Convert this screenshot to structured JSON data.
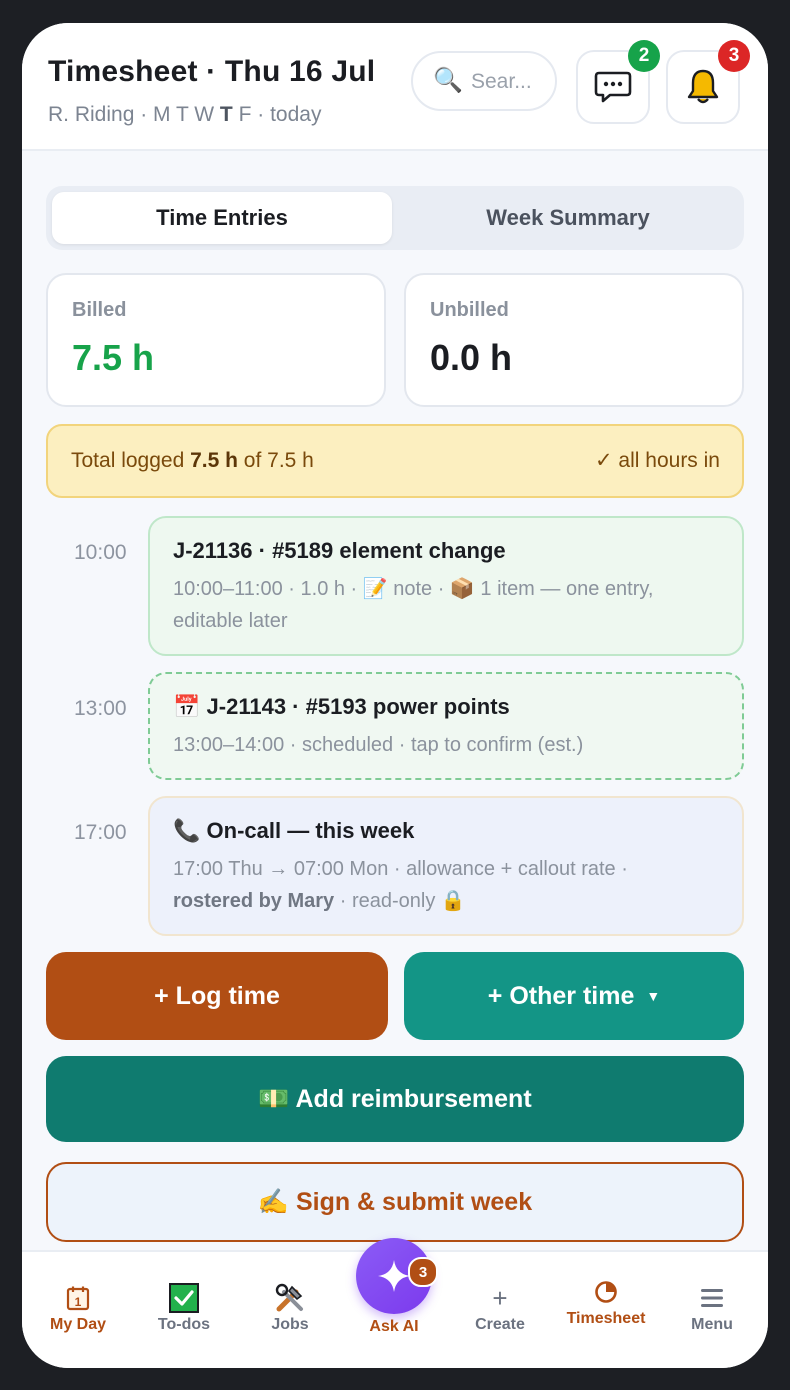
{
  "header": {
    "title": "Timesheet · Thu 16 Jul",
    "subtitle_prefix": "R. Riding · M T W ",
    "subtitle_bold": "T",
    "subtitle_suffix": " F · today",
    "search_placeholder": "Sear...",
    "search_icon": "magnifier-icon",
    "messages_icon": "chat-bubble-icon",
    "messages_count": "2",
    "notifications_icon": "bell-icon",
    "notifications_count": "3"
  },
  "tabs": [
    {
      "label": "Time Entries",
      "active": true
    },
    {
      "label": "Week Summary",
      "active": false
    }
  ],
  "stats": {
    "billed_label": "Billed",
    "billed_value": "7.5 h",
    "unbilled_label": "Unbilled",
    "unbilled_value": "0.0 h"
  },
  "total": {
    "prefix": "Total logged ",
    "logged": "7.5 h",
    "suffix": " of 7.5 h",
    "status": "✓ all hours in"
  },
  "entries": [
    {
      "time": "10:00",
      "title": "J-21136 · #5189 element change",
      "meta": "10:00–11:00 · 1.0 h · 📝 note · 📦 1 item — one entry, editable later"
    },
    {
      "time": "13:00",
      "icon": "📅",
      "title": "J-21143 · #5193 power points",
      "meta": "13:00–14:00 · scheduled · tap to confirm (est.)"
    },
    {
      "time": "17:00",
      "icon": "📞",
      "title": "On-call — this week",
      "meta_prefix": "17:00 Thu → 07:00 Mon · allowance + callout rate · ",
      "meta_bold": "rostered by Mary",
      "meta_suffix": " · read-only 🔒"
    }
  ],
  "actions": {
    "log_time": "+ Log time",
    "other_time": "+ Other time",
    "reimbursement": "💵 Add reimbursement",
    "sign_submit": "✍️ Sign & submit week"
  },
  "nav": [
    {
      "label": "My Day",
      "icon": "calendar-icon",
      "active": true
    },
    {
      "label": "To-dos",
      "icon": "checkbox-icon",
      "active": false
    },
    {
      "label": "Jobs",
      "icon": "tools-icon",
      "active": false
    },
    {
      "label": "Ask AI",
      "icon": "sparkle-icon",
      "badge": "3",
      "active": true
    },
    {
      "label": "Create",
      "icon": "plus-icon",
      "active": false
    },
    {
      "label": "Timesheet",
      "icon": "pie-chart-icon",
      "active": true
    },
    {
      "label": "Menu",
      "icon": "hamburger-icon",
      "active": false
    }
  ],
  "colors": {
    "accent": "#b14e14",
    "teal": "#139586",
    "teal_dark": "#0f7b6f",
    "billed_green": "#17a34a",
    "badge_green": "#16a34a",
    "badge_red": "#dc2626",
    "ask_purple": "#7c3aed"
  }
}
